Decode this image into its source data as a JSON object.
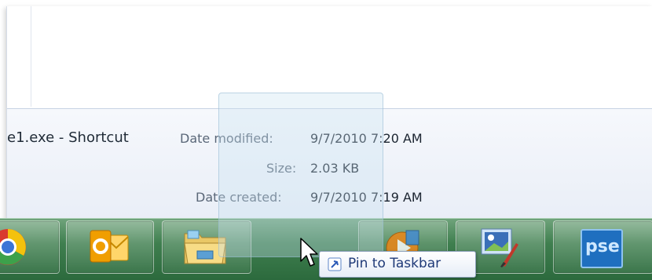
{
  "details": {
    "file_name": "e1.exe - Shortcut",
    "date_modified_label": "Date modified:",
    "date_modified_value": "9/7/2010 7:20 AM",
    "size_label": "Size:",
    "size_value": "2.03 KB",
    "date_created_label": "Date created:",
    "date_created_value": "9/7/2010 7:19 AM"
  },
  "taskbar": {
    "color": "#3f7f4f",
    "items": [
      {
        "icon": "chrome-icon"
      },
      {
        "icon": "outlook-icon"
      },
      {
        "icon": "file-explorer-icon"
      },
      {
        "icon": "media-player-icon"
      },
      {
        "icon": "paint-icon"
      },
      {
        "icon": "photoshop-elements-icon",
        "label": "pse"
      }
    ]
  },
  "tooltip": {
    "label": "Pin to Taskbar",
    "icon": "pin-icon"
  },
  "cursor": {
    "icon": "mouse-pointer-icon"
  }
}
